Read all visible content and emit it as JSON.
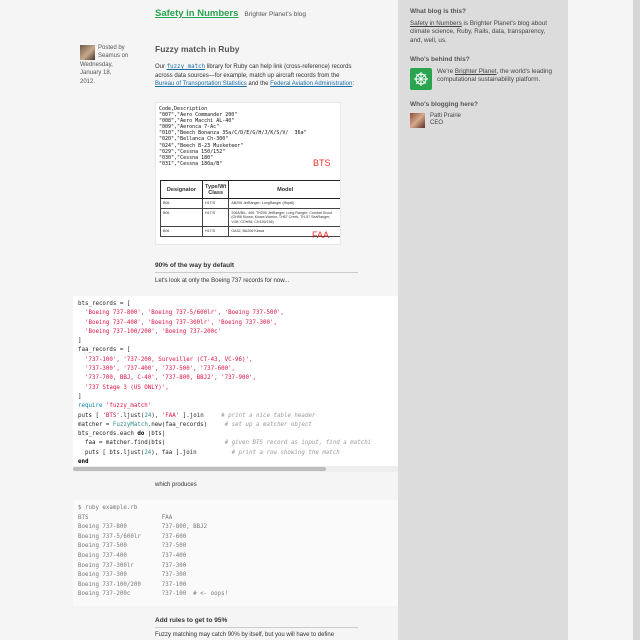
{
  "blog": {
    "title": "Safety in Numbers",
    "tagline": "Brighter Planet's blog"
  },
  "post": {
    "meta": [
      "Posted by",
      "Seamus on",
      "Wednesday,",
      "January 18,",
      "2012."
    ],
    "title": "Fuzzy match in Ruby",
    "intro": {
      "t1": "Our ",
      "lib_link": "fuzzy_match",
      "t2": " library for Ruby can help link (cross-reference) records across data sources—for example, match up aircraft records from the ",
      "bts_link": "Bureau of Transportation Statistics",
      "t3": " and the ",
      "faa_link": "Federal Aviation Administration",
      "t4": ":"
    }
  },
  "figure": {
    "code_lines": "Code,Description\n\"007\",\"Aero Commander 200\"\n\"008\",\"Aero Macchi AL-40\"\n\"009\",\"Aeronca 7-Ac\"\n\"010\",\"Beech Bonanza 35a/C/D/E/G/H/J/K/S/V/  36a\"\n\"020\",\"Bellanca Ch-300\"\n\"024\",\"Beech B-23 Musketeer\"\n\"029\",\"Cessna 150/152\"\n\"030\",\"Cessna 180\"\n\"031\",\"Cessna 180a/B\"",
    "bts_label": "BTS",
    "faa_label": "FAA",
    "table_headers": [
      "Designator",
      "Type/Wt\nClass",
      "Model"
    ],
    "table_rows": [
      [
        "B06",
        "H1T/S",
        "AB206 JetRanger; LongRanger (Hkpt6)"
      ],
      [
        "B06",
        "H1T/S",
        "206A/B/L, 406, TH206 JetRanger; Long Ranger; Combat Scout (OH58 Kiowa, Kiowa Warrior, TH67 Creek, TH-57 SeaRanger, V4H, COH58, CH139/136)"
      ],
      [
        "B06",
        "H1T/S",
        "OA32, BA206 Kiowa"
      ]
    ]
  },
  "section1": {
    "heading": "90% of the way by default",
    "text": "Let's look at only the Boeing 737 records for now..."
  },
  "code1": {
    "lines": [
      [
        {
          "t": "bts_records = [",
          "c": ""
        }
      ],
      [
        {
          "t": "  'Boeing 737-800', 'Boeing 737-5/600lr', 'Boeing 737-500',",
          "c": "c-red"
        }
      ],
      [
        {
          "t": "  'Boeing 737-400', 'Boeing 737-300lr', 'Boeing 737-300',",
          "c": "c-red"
        }
      ],
      [
        {
          "t": "  'Boeing 737-100/200', 'Boeing 737-200c'",
          "c": "c-red"
        }
      ],
      [
        {
          "t": "]",
          "c": ""
        }
      ],
      [
        {
          "t": "faa_records = [",
          "c": ""
        }
      ],
      [
        {
          "t": "  '737-100', '737-200, Surveiller (CT-43, VC-96)',",
          "c": "c-red"
        }
      ],
      [
        {
          "t": "  '737-300', '737-400', '737-500', '737-600',",
          "c": "c-red"
        }
      ],
      [
        {
          "t": "  '737-700, BBJ, C-40', '737-800, BBJ2', '737-900',",
          "c": "c-red"
        }
      ],
      [
        {
          "t": "  '737 Stage 3 (US ONLY)',",
          "c": "c-red"
        }
      ],
      [
        {
          "t": "]",
          "c": ""
        }
      ],
      [
        {
          "t": "require ",
          "c": "c-blue"
        },
        {
          "t": "'fuzzy_match'",
          "c": "c-red"
        }
      ],
      [
        {
          "t": "puts [ ",
          "c": ""
        },
        {
          "t": "'BTS'",
          "c": "c-red"
        },
        {
          "t": ".ljust(",
          "c": ""
        },
        {
          "t": "24",
          "c": "c-teal"
        },
        {
          "t": "), ",
          "c": ""
        },
        {
          "t": "'FAA'",
          "c": "c-red"
        },
        {
          "t": " ].join     ",
          "c": ""
        },
        {
          "t": "# print a nice table header",
          "c": "c-cmt"
        }
      ],
      [
        {
          "t": "matcher = ",
          "c": ""
        },
        {
          "t": "FuzzyMatch",
          "c": "c-teal"
        },
        {
          "t": ".new(faa_records)     ",
          "c": ""
        },
        {
          "t": "# set up a matcher object",
          "c": "c-cmt"
        }
      ],
      [
        {
          "t": "bts_records.each ",
          "c": ""
        },
        {
          "t": "do",
          "c": "c-kw"
        },
        {
          "t": " |bts|",
          "c": ""
        }
      ],
      [
        {
          "t": "  faa = matcher.find(bts)                 ",
          "c": ""
        },
        {
          "t": "# given BTS record as input, find a matchi",
          "c": "c-cmt"
        }
      ],
      [
        {
          "t": "  puts [ bts.ljust(",
          "c": ""
        },
        {
          "t": "24",
          "c": "c-teal"
        },
        {
          "t": "), faa ].join          ",
          "c": ""
        },
        {
          "t": "# print a row showing the match",
          "c": "c-cmt"
        }
      ],
      [
        {
          "t": "end",
          "c": "c-kw"
        }
      ]
    ]
  },
  "section2": {
    "text": "which produces"
  },
  "code2": {
    "lines": [
      "$ ruby example.rb",
      "BTS                     FAA",
      "Boeing 737-800          737-800, BBJ2",
      "Boeing 737-5/600lr      737-600",
      "Boeing 737-500          737-500",
      "Boeing 737-400          737-400",
      "Boeing 737-300lr        737-300",
      "Boeing 737-300          737-300",
      "Boeing 737-100/200      737-100",
      "Boeing 737-200c         737-100  # <- oops!"
    ]
  },
  "section3": {
    "heading": "Add rules to get to 95%",
    "text": "Fuzzy matching may catch 90% by itself, but you will have to define"
  },
  "sidebar": {
    "about_heading": "What blog is this?",
    "about_link": "Safety in Numbers",
    "about_text": " is Brighter Planet's blog about climate science, Ruby, Rails, data, transparency, and, well, us.",
    "behind_heading": "Who's behind this?",
    "behind_t1": "We're ",
    "behind_link": "Brighter Planet",
    "behind_t2": ", the world's leading computational sustainability platform.",
    "blogging_heading": "Who's blogging here?",
    "author_name": "Patti Prairie",
    "author_role": "CEO"
  }
}
